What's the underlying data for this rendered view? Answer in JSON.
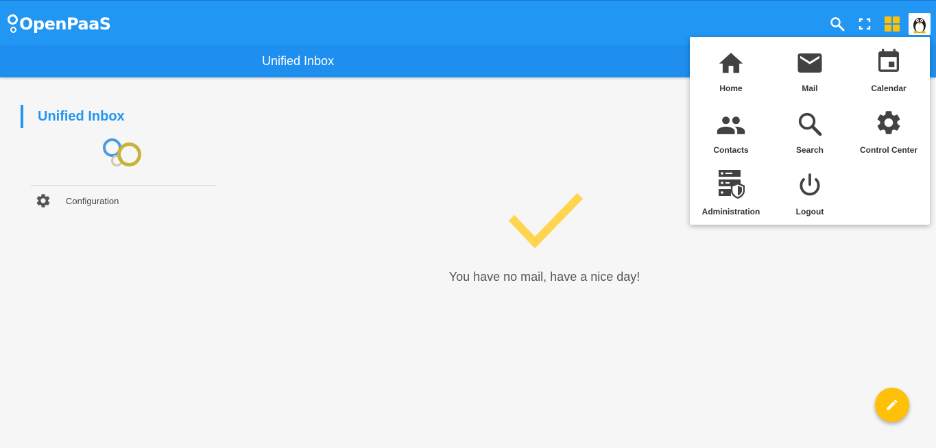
{
  "brand": {
    "name": "OpenPaaS"
  },
  "topbar": {
    "search_icon": "search-icon",
    "fullscreen_icon": "fullscreen-icon",
    "apps_icon": "apps-grid-icon",
    "avatar_icon": "penguin-avatar"
  },
  "subheader": {
    "title": "Unified Inbox"
  },
  "sidebar": {
    "title": "Unified Inbox",
    "items": [
      {
        "label": "Configuration",
        "icon": "gear-icon"
      }
    ]
  },
  "main": {
    "empty_message": "You have no mail, have a nice day!"
  },
  "app_menu": {
    "items": [
      {
        "label": "Home",
        "icon": "home-icon"
      },
      {
        "label": "Mail",
        "icon": "mail-icon"
      },
      {
        "label": "Calendar",
        "icon": "calendar-icon"
      },
      {
        "label": "Contacts",
        "icon": "contacts-icon"
      },
      {
        "label": "Search",
        "icon": "search-icon"
      },
      {
        "label": "Control Center",
        "icon": "gear-icon"
      },
      {
        "label": "Administration",
        "icon": "admin-server-icon"
      },
      {
        "label": "Logout",
        "icon": "power-icon"
      }
    ]
  },
  "colors": {
    "primary": "#2196f3",
    "accent": "#ffc107",
    "check": "#ffd54f",
    "icon": "#424242"
  }
}
